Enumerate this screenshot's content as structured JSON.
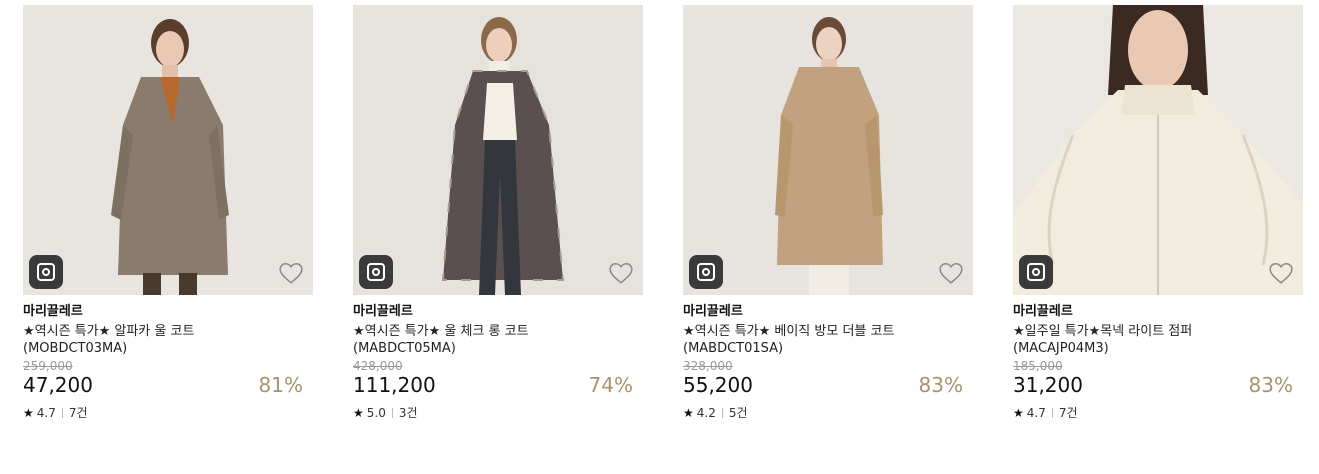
{
  "products": [
    {
      "brand": "마리끌레르",
      "name": "★역시즌 특가★ 알파카 울 코트",
      "code": "(MOBDCT03MA)",
      "original_price": "259,000",
      "price": "47,200",
      "discount": "81%",
      "star": "★",
      "rating": "4.7",
      "reviews": "7건",
      "icons": {
        "instagram": "instagram-icon",
        "wishlist": "heart-icon"
      }
    },
    {
      "brand": "마리끌레르",
      "name": "★역시즌 특가★ 울 체크 롱 코트",
      "code": "(MABDCT05MA)",
      "original_price": "428,000",
      "price": "111,200",
      "discount": "74%",
      "star": "★",
      "rating": "5.0",
      "reviews": "3건",
      "icons": {
        "instagram": "instagram-icon",
        "wishlist": "heart-icon"
      }
    },
    {
      "brand": "마리끌레르",
      "name": "★역시즌 특가★ 베이직 방모 더블 코트",
      "code": "(MABDCT01SA)",
      "original_price": "328,000",
      "price": "55,200",
      "discount": "83%",
      "star": "★",
      "rating": "4.2",
      "reviews": "5건",
      "icons": {
        "instagram": "instagram-icon",
        "wishlist": "heart-icon"
      }
    },
    {
      "brand": "마리끌레르",
      "name": "★일주일 특가★목넥 라이트 점퍼",
      "code": "(MACAJP04M3)",
      "original_price": "185,000",
      "price": "31,200",
      "discount": "83%",
      "star": "★",
      "rating": "4.7",
      "reviews": "7건",
      "icons": {
        "instagram": "instagram-icon",
        "wishlist": "heart-icon"
      }
    }
  ],
  "colors": {
    "discount": "#a8946a",
    "original_price": "#999999",
    "instagram_badge": "#3a3a3a"
  }
}
